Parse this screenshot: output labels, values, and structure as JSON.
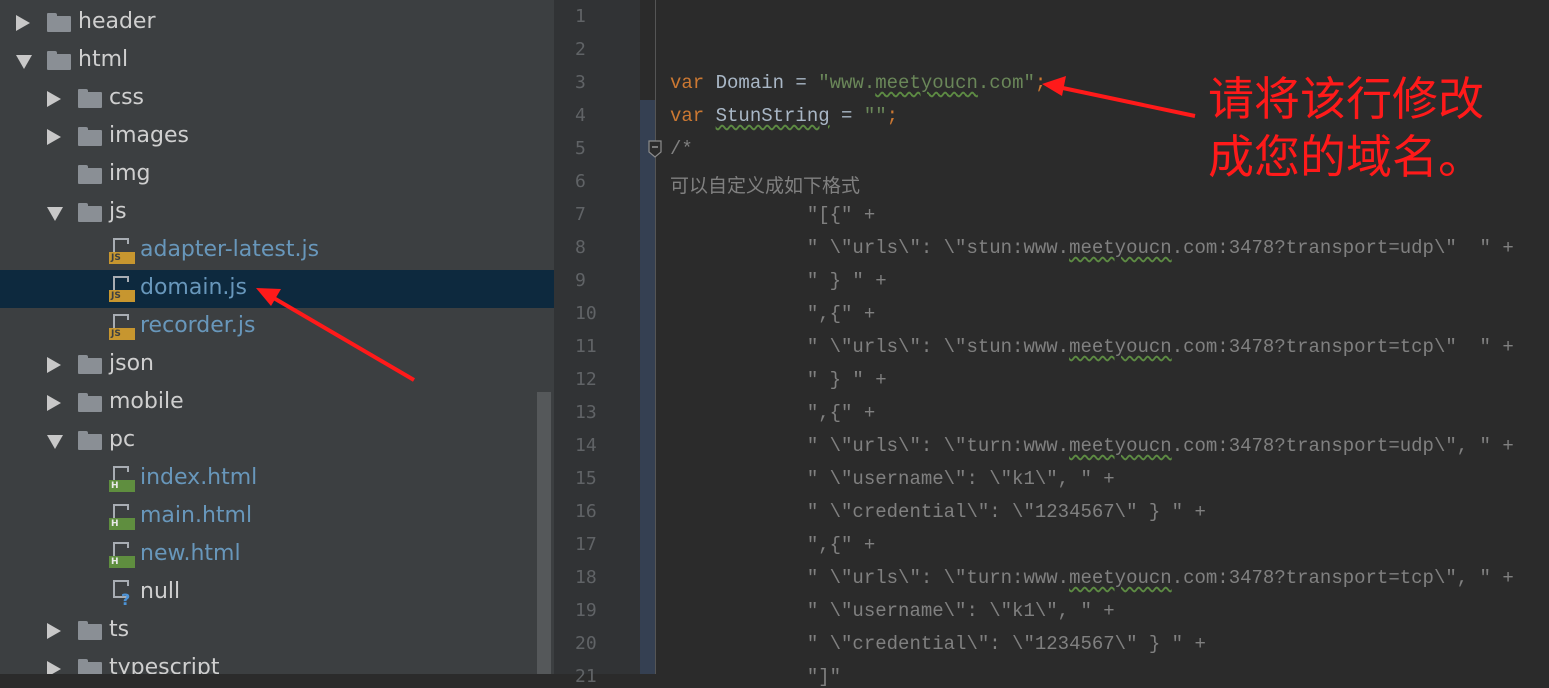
{
  "project_tree": {
    "items": [
      {
        "label": "header",
        "type": "folder",
        "state": "collapsed",
        "indent": 0
      },
      {
        "label": "html",
        "type": "folder",
        "state": "expanded",
        "indent": 0
      },
      {
        "label": "css",
        "type": "folder",
        "state": "collapsed",
        "indent": 1
      },
      {
        "label": "images",
        "type": "folder",
        "state": "collapsed",
        "indent": 1
      },
      {
        "label": "img",
        "type": "folder",
        "state": "none",
        "indent": 1
      },
      {
        "label": "js",
        "type": "folder",
        "state": "expanded",
        "indent": 1
      },
      {
        "label": "adapter-latest.js",
        "type": "js",
        "state": "none",
        "indent": 2,
        "badge": "JS"
      },
      {
        "label": "domain.js",
        "type": "js",
        "state": "none",
        "indent": 2,
        "badge": "JS",
        "selected": true
      },
      {
        "label": "recorder.js",
        "type": "js",
        "state": "none",
        "indent": 2,
        "badge": "JS"
      },
      {
        "label": "json",
        "type": "folder",
        "state": "collapsed",
        "indent": 1
      },
      {
        "label": "mobile",
        "type": "folder",
        "state": "collapsed",
        "indent": 1
      },
      {
        "label": "pc",
        "type": "folder",
        "state": "expanded",
        "indent": 1
      },
      {
        "label": "index.html",
        "type": "html",
        "state": "none",
        "indent": 2,
        "badge": "H"
      },
      {
        "label": "main.html",
        "type": "html",
        "state": "none",
        "indent": 2,
        "badge": "H"
      },
      {
        "label": "new.html",
        "type": "html",
        "state": "none",
        "indent": 2,
        "badge": "H"
      },
      {
        "label": "null",
        "type": "unknown",
        "state": "none",
        "indent": 2,
        "badge": "?"
      },
      {
        "label": "ts",
        "type": "folder",
        "state": "collapsed",
        "indent": 1
      },
      {
        "label": "typescript",
        "type": "folder",
        "state": "collapsed",
        "indent": 1
      }
    ]
  },
  "editor": {
    "line_numbers": [
      "1",
      "2",
      "3",
      "4",
      "5",
      "6",
      "7",
      "8",
      "9",
      "10",
      "11",
      "12",
      "13",
      "14",
      "15",
      "16",
      "17",
      "18",
      "19",
      "20",
      "21"
    ],
    "lines": [
      [],
      [],
      [
        {
          "t": "var ",
          "c": "kw"
        },
        {
          "t": "Domain = ",
          "c": "plain"
        },
        {
          "t": "\"www.",
          "c": "str"
        },
        {
          "t": "meetyoucn",
          "c": "str",
          "w": true
        },
        {
          "t": ".com\"",
          "c": "str"
        },
        {
          "t": ";",
          "c": "semi"
        }
      ],
      [
        {
          "t": "var ",
          "c": "kw"
        },
        {
          "t": "StunString",
          "c": "plain",
          "w": true
        },
        {
          "t": " = ",
          "c": "plain"
        },
        {
          "t": "\"\"",
          "c": "str"
        },
        {
          "t": ";",
          "c": "semi"
        }
      ],
      [
        {
          "t": "/*",
          "c": "comment"
        }
      ],
      [
        {
          "t": "可以自定义成如下格式",
          "c": "comment"
        }
      ],
      [
        {
          "t": "            \"[{\" +",
          "c": "comment"
        }
      ],
      [
        {
          "t": "            \" \\\"urls\\\": \\\"stun:www.",
          "c": "comment"
        },
        {
          "t": "meetyoucn",
          "c": "comment",
          "w": true
        },
        {
          "t": ".com:3478?transport=udp\\\"  \" +",
          "c": "comment"
        }
      ],
      [
        {
          "t": "            \" } \" +",
          "c": "comment"
        }
      ],
      [
        {
          "t": "            \",{\" +",
          "c": "comment"
        }
      ],
      [
        {
          "t": "            \" \\\"urls\\\": \\\"stun:www.",
          "c": "comment"
        },
        {
          "t": "meetyoucn",
          "c": "comment",
          "w": true
        },
        {
          "t": ".com:3478?transport=tcp\\\"  \" +",
          "c": "comment"
        }
      ],
      [
        {
          "t": "            \" } \" +",
          "c": "comment"
        }
      ],
      [
        {
          "t": "            \",{\" +",
          "c": "comment"
        }
      ],
      [
        {
          "t": "            \" \\\"urls\\\": \\\"turn:www.",
          "c": "comment"
        },
        {
          "t": "meetyoucn",
          "c": "comment",
          "w": true
        },
        {
          "t": ".com:3478?transport=udp\\\", \" +",
          "c": "comment"
        }
      ],
      [
        {
          "t": "            \" \\\"username\\\": \\\"k1\\\", \" +",
          "c": "comment"
        }
      ],
      [
        {
          "t": "            \" \\\"credential\\\": \\\"1234567\\\" } \" +",
          "c": "comment"
        }
      ],
      [
        {
          "t": "            \",{\" +",
          "c": "comment"
        }
      ],
      [
        {
          "t": "            \" \\\"urls\\\": \\\"turn:www.",
          "c": "comment"
        },
        {
          "t": "meetyoucn",
          "c": "comment",
          "w": true
        },
        {
          "t": ".com:3478?transport=tcp\\\", \" +",
          "c": "comment"
        }
      ],
      [
        {
          "t": "            \" \\\"username\\\": \\\"k1\\\", \" +",
          "c": "comment"
        }
      ],
      [
        {
          "t": "            \" \\\"credential\\\": \\\"1234567\\\" } \" +",
          "c": "comment"
        }
      ],
      [
        {
          "t": "            \"]\"",
          "c": "comment"
        }
      ]
    ]
  },
  "annotation": {
    "line1": "请将该行修改",
    "line2": "成您的域名。",
    "color": "#ff1a1a"
  },
  "colors": {
    "tree_bg": "#3c3f41",
    "selection": "#0d293e",
    "editor_bg": "#2b2b2b",
    "keyword": "#cc7832",
    "string": "#6a8759",
    "comment": "#808080"
  }
}
